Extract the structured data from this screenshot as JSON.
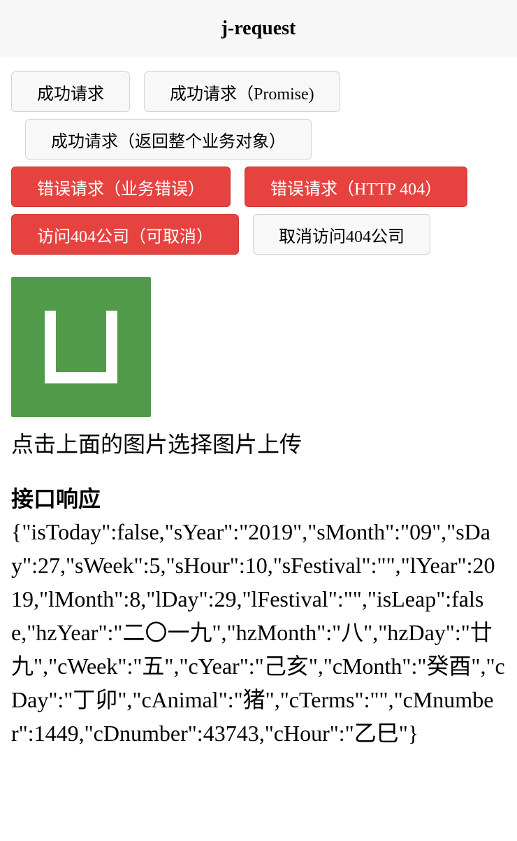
{
  "header": {
    "title": "j-request"
  },
  "buttons": {
    "success": "成功请求",
    "success_promise": "成功请求（Promise)",
    "success_whole": "成功请求（返回整个业务对象）",
    "error_business": "错误请求（业务错误）",
    "error_http": "错误请求（HTTP 404）",
    "visit_404": "访问404公司（可取消）",
    "cancel_404": "取消访问404公司"
  },
  "uploader": {
    "icon": "upload-u-icon",
    "color": "#519a4a",
    "hint": "点击上面的图片选择图片上传"
  },
  "response": {
    "title": "接口响应",
    "body": "{\"isToday\":false,\"sYear\":\"2019\",\"sMonth\":\"09\",\"sDay\":27,\"sWeek\":5,\"sHour\":10,\"sFestival\":\"\",\"lYear\":2019,\"lMonth\":8,\"lDay\":29,\"lFestival\":\"\",\"isLeap\":false,\"hzYear\":\"二〇一九\",\"hzMonth\":\"八\",\"hzDay\":\"廿九\",\"cWeek\":\"五\",\"cYear\":\"己亥\",\"cMonth\":\"癸酉\",\"cDay\":\"丁卯\",\"cAnimal\":\"猪\",\"cTerms\":\"\",\"cMnumber\":1449,\"cDnumber\":43743,\"cHour\":\"乙巳\"}"
  }
}
